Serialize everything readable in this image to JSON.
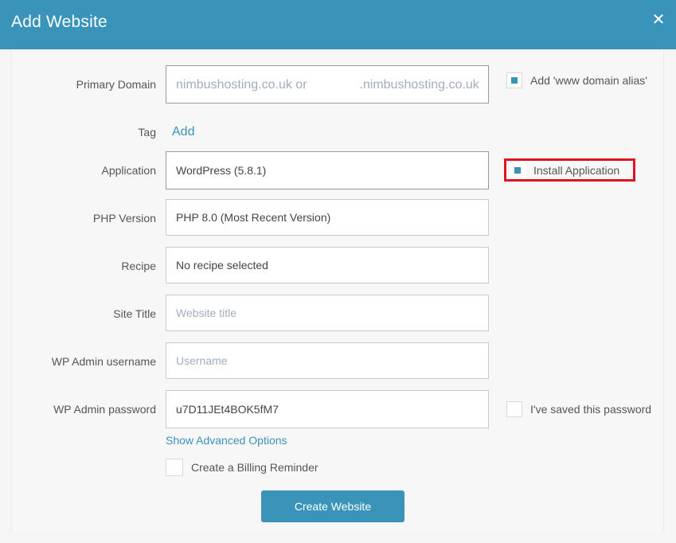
{
  "modal": {
    "title": "Add Website",
    "close_icon": "close-icon"
  },
  "form": {
    "primary_domain": {
      "label": "Primary Domain",
      "placeholder_prefix": "nimbushosting.co.uk or",
      "placeholder_suffix": ".nimbushosting.co.uk"
    },
    "www_alias": {
      "label": "Add 'www domain alias'",
      "checked": true
    },
    "tag": {
      "label": "Tag",
      "add_link": "Add"
    },
    "application": {
      "label": "Application",
      "value": "WordPress (5.8.1)"
    },
    "install_application": {
      "label": "Install Application",
      "checked": true
    },
    "php_version": {
      "label": "PHP Version",
      "value": "PHP 8.0 (Most Recent Version)"
    },
    "recipe": {
      "label": "Recipe",
      "value": "No recipe selected"
    },
    "site_title": {
      "label": "Site Title",
      "placeholder": "Website title"
    },
    "wp_admin_username": {
      "label": "WP Admin username",
      "placeholder": "Username"
    },
    "wp_admin_password": {
      "label": "WP Admin password",
      "value": "u7D11JEt4BOK5fM7"
    },
    "saved_password": {
      "label": "I've saved this password",
      "checked": false
    },
    "advanced_options_link": "Show Advanced Options",
    "billing_reminder": {
      "label": "Create a Billing Reminder",
      "checked": false
    },
    "submit_label": "Create Website"
  },
  "colors": {
    "accent": "#3a93b9",
    "highlight": "#e0141e"
  }
}
